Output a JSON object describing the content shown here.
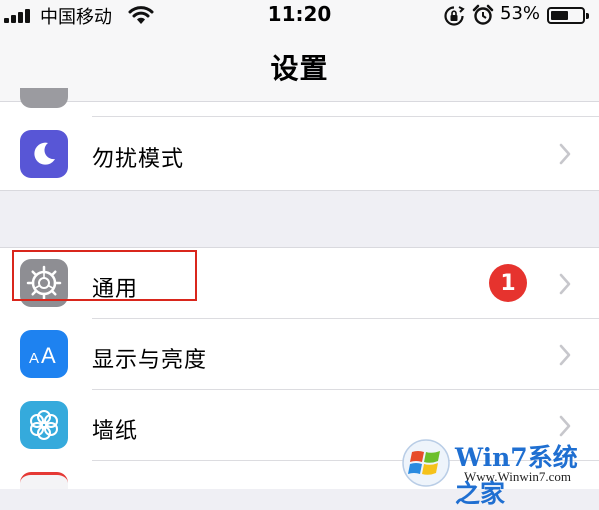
{
  "status_bar": {
    "carrier": "中国移动",
    "time": "11:20",
    "battery_percent": "53%",
    "battery_level": 0.53,
    "icons": [
      "signal-icon",
      "wifi-icon",
      "rotation-lock-icon",
      "alarm-icon",
      "battery-icon"
    ]
  },
  "nav": {
    "title": "设置"
  },
  "settings_rows": [
    {
      "label": "勿扰模式",
      "icon": "moon-icon",
      "icon_color": "#5856d6"
    },
    {
      "label": "通用",
      "icon": "gear-icon",
      "icon_color": "#8e8e93",
      "badge": "1",
      "badge_color": "#e6332e"
    },
    {
      "label": "显示与亮度",
      "icon": "text-size-icon",
      "icon_color": "#1e82f0"
    },
    {
      "label": "墙纸",
      "icon": "flower-icon",
      "icon_color": "#35aadc"
    }
  ],
  "watermark": {
    "title": "Win7系统之家",
    "url": "Www.Winwin7.com"
  },
  "colors": {
    "highlight": "#d9261c",
    "background": "#efeff4"
  }
}
